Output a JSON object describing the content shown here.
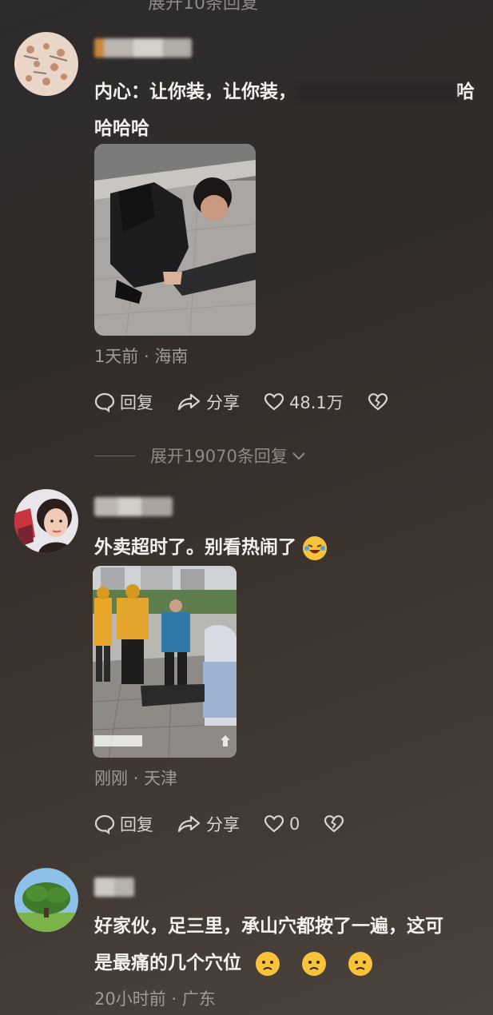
{
  "top_partial": "展开10条回复",
  "comments": [
    {
      "text_line1_prefix": "内心：让你装，让你装，",
      "text_line1_suffix": "哈",
      "text_line2": "哈哈哈",
      "time": "1天前",
      "location": "海南",
      "reply_label": "回复",
      "share_label": "分享",
      "like_count": "48.1万",
      "expand_label": "展开19070条回复"
    },
    {
      "text": "外卖超时了。别看热闹了",
      "time": "刚刚",
      "location": "天津",
      "reply_label": "回复",
      "share_label": "分享",
      "like_count": "0"
    },
    {
      "text_line1": "好家伙，足三里，承山穴都按了一遍，这可",
      "text_line2": "是最痛的几个穴位",
      "time": "20小时前",
      "location": "广东"
    }
  ],
  "separator": "·",
  "colors": {
    "background_top": "#2c2b2d",
    "background_bottom": "#4b423c",
    "meta_text": "#a09a95",
    "emoji": "#f6c33a"
  },
  "icons": [
    "reply-icon",
    "share-icon",
    "heart-icon",
    "broken-heart-icon",
    "chevron-down-icon",
    "laugh-emoji-icon",
    "worried-emoji-icon"
  ]
}
